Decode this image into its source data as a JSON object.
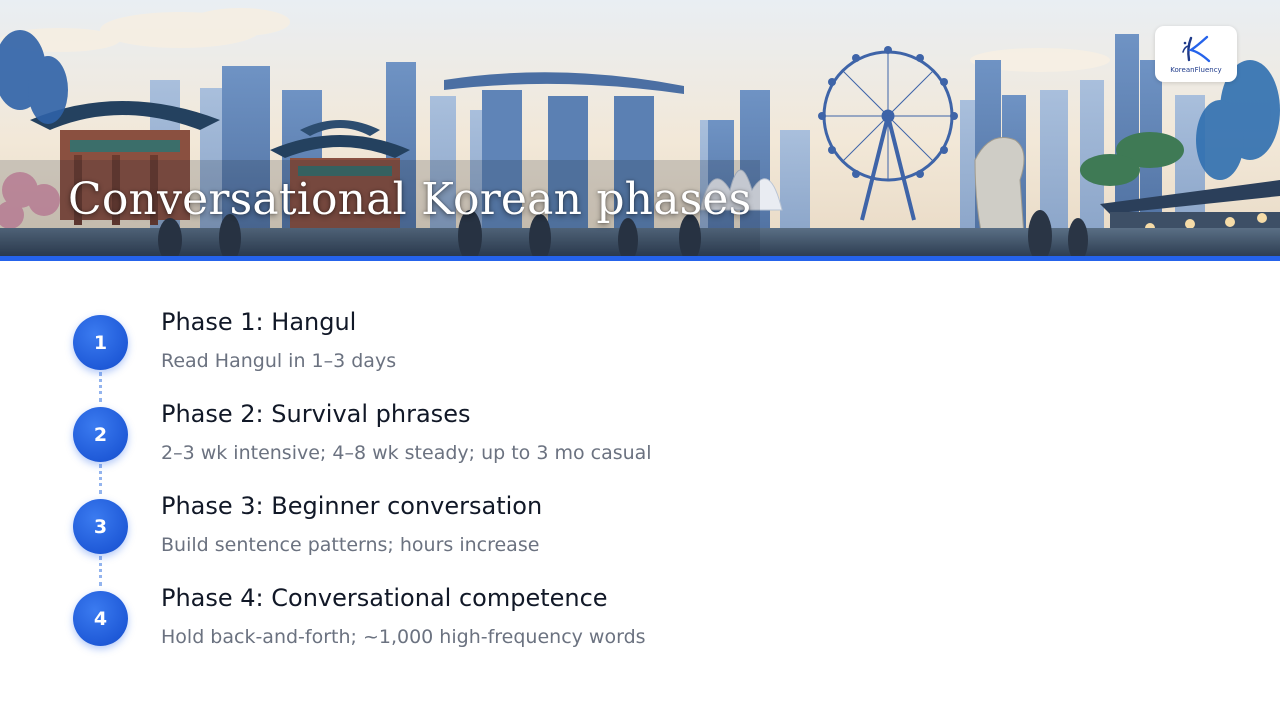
{
  "slide": {
    "title": "Conversational Korean phases"
  },
  "logo": {
    "brand": "KoreanFluency",
    "mark_icon": "k-calligraphy-logo-icon"
  },
  "colors": {
    "accent": "#2563eb",
    "step_circle": "#1f5ad8",
    "title_text": "#111827",
    "desc_text": "#6b7280",
    "connector": "#93b4ee"
  },
  "steps": [
    {
      "number": "1",
      "title": "Phase 1: Hangul",
      "description": "Read Hangul in 1–3 days"
    },
    {
      "number": "2",
      "title": "Phase 2: Survival phrases",
      "description": "2–3 wk intensive; 4–8 wk steady; up to 3 mo casual"
    },
    {
      "number": "3",
      "title": "Phase 3: Beginner conversation",
      "description": "Build sentence patterns; hours increase"
    },
    {
      "number": "4",
      "title": "Phase 4: Conversational competence",
      "description": "Hold back-and-forth; ~1,000 high-frequency words"
    }
  ]
}
